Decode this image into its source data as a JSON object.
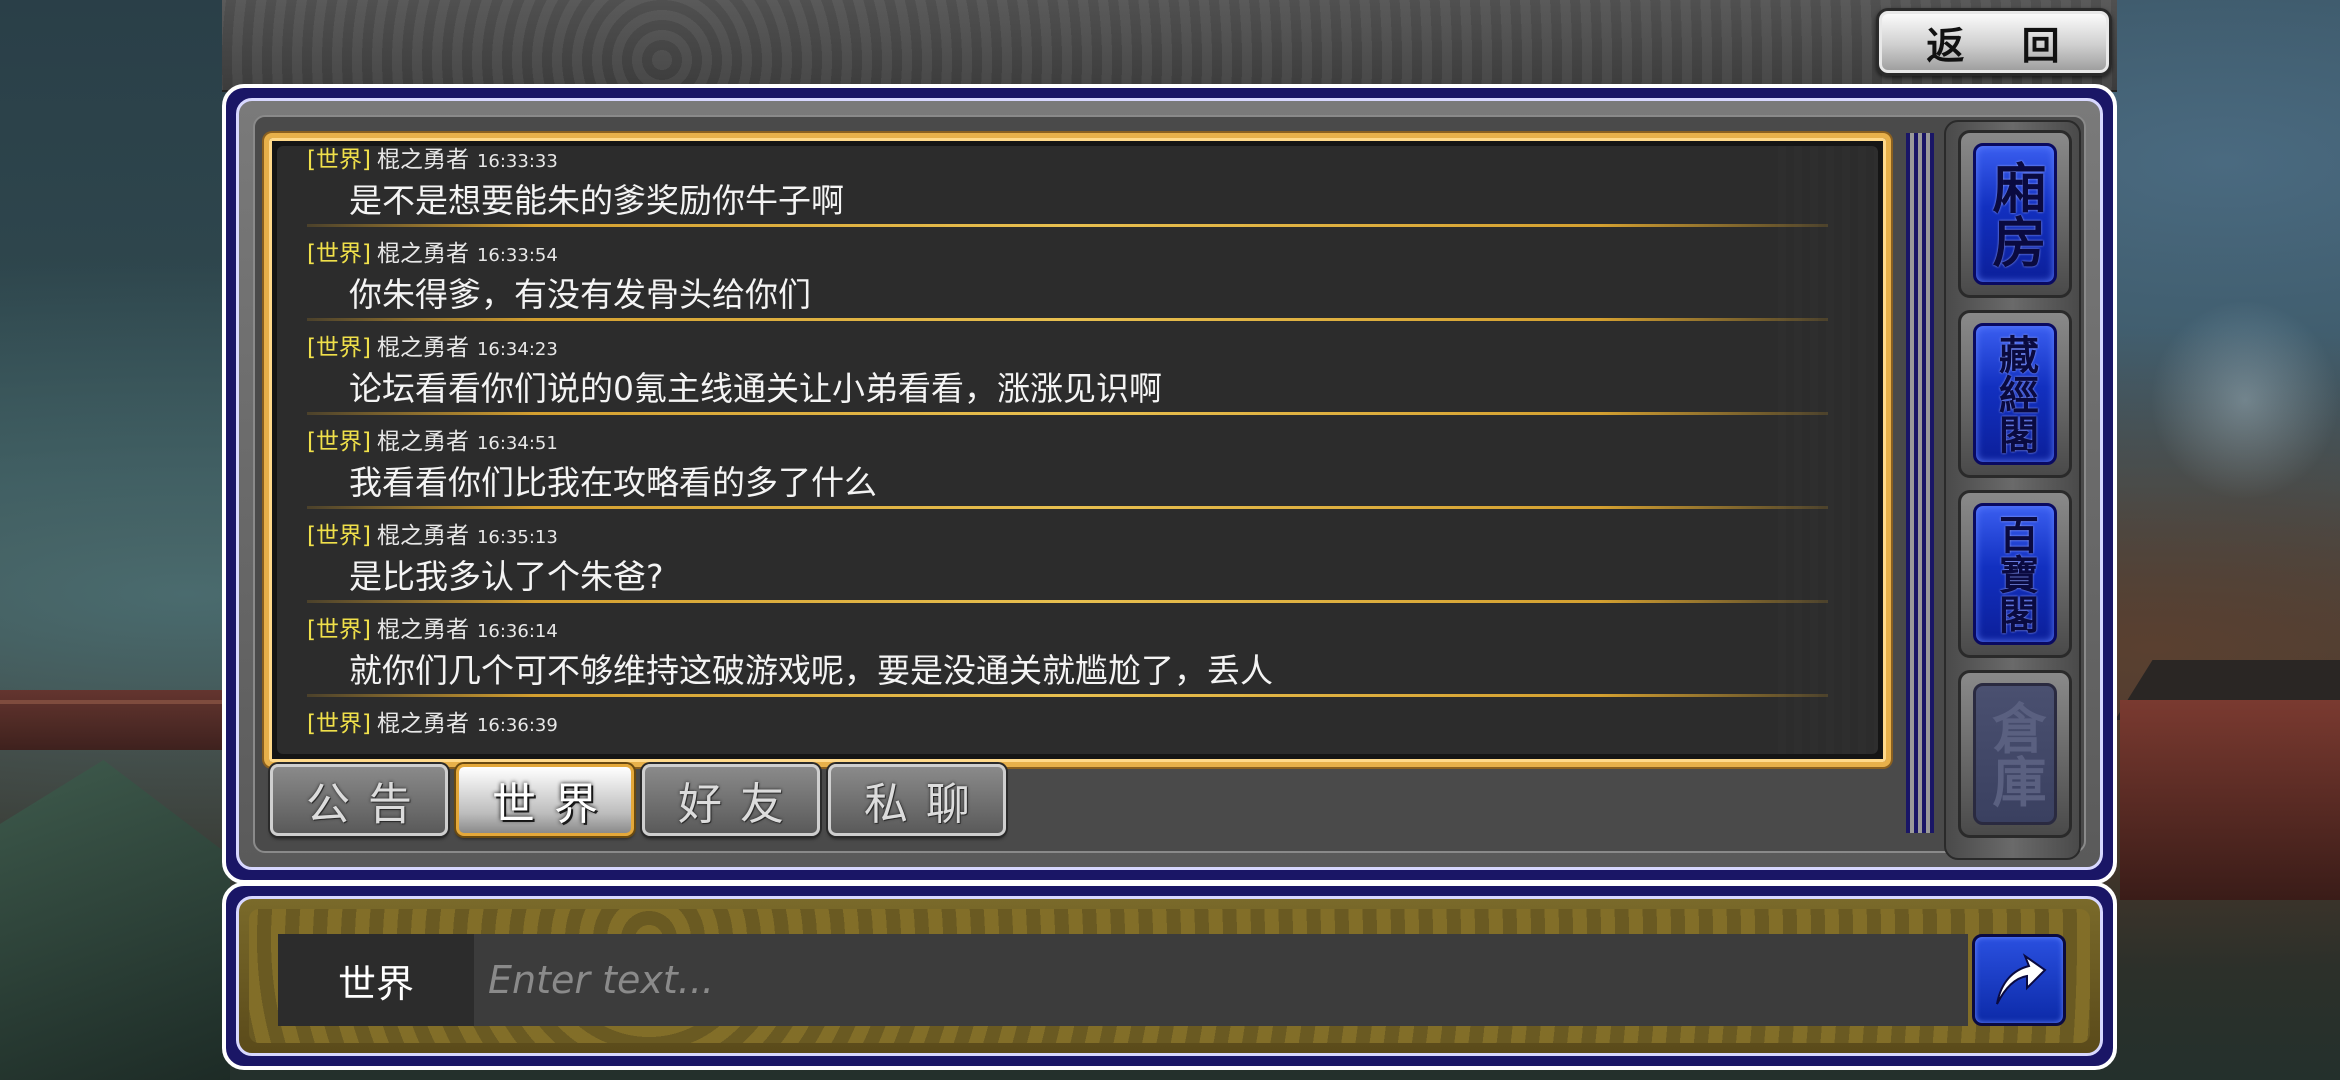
{
  "header": {
    "return_label": "返 回"
  },
  "chat": {
    "messages": [
      {
        "channel": "[世界]",
        "user": "棍之勇者",
        "time": "16:33:33",
        "text": "是不是想要能朱的爹奖励你牛子啊"
      },
      {
        "channel": "[世界]",
        "user": "棍之勇者",
        "time": "16:33:54",
        "text": "你朱得爹，有没有发骨头给你们"
      },
      {
        "channel": "[世界]",
        "user": "棍之勇者",
        "time": "16:34:23",
        "text": "论坛看看你们说的0氪主线通关让小弟看看，涨涨见识啊"
      },
      {
        "channel": "[世界]",
        "user": "棍之勇者",
        "time": "16:34:51",
        "text": "我看看你们比我在攻略看的多了什么"
      },
      {
        "channel": "[世界]",
        "user": "棍之勇者",
        "time": "16:35:13",
        "text": "是比我多认了个朱爸?"
      },
      {
        "channel": "[世界]",
        "user": "棍之勇者",
        "time": "16:36:14",
        "text": "就你们几个可不够维持这破游戏呢，要是没通关就尴尬了，丢人"
      },
      {
        "channel": "[世界]",
        "user": "棍之勇者",
        "time": "16:36:39",
        "text": ""
      }
    ]
  },
  "tabs": [
    {
      "label": "公告",
      "active": false
    },
    {
      "label": "世界",
      "active": true
    },
    {
      "label": "好友",
      "active": false
    },
    {
      "label": "私聊",
      "active": false
    }
  ],
  "side_menu": [
    {
      "label": "廂房",
      "enabled": true
    },
    {
      "label": "藏經閣",
      "enabled": true
    },
    {
      "label": "百寶閣",
      "enabled": true
    },
    {
      "label": "倉庫",
      "enabled": false
    }
  ],
  "input_bar": {
    "channel_label": "世界",
    "placeholder": "Enter text...",
    "value": ""
  },
  "icons": {
    "send": "send-arrow-icon"
  },
  "colors": {
    "channel_tag": "#f0e04a",
    "accent_gold": "#e7b04a",
    "frame_blue": "#1a1666",
    "button_blue": "#1230c0"
  }
}
